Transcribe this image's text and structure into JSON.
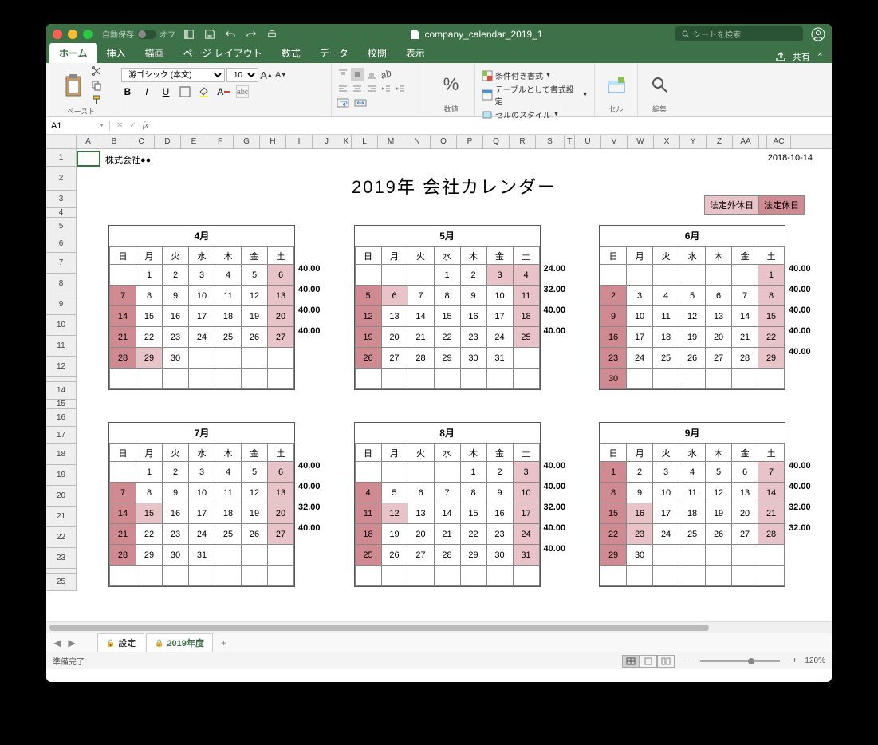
{
  "titlebar": {
    "autosave": "自動保存",
    "autosave_state": "オフ",
    "filename": "company_calendar_2019_1",
    "search_placeholder": "シートを検索"
  },
  "tabs": {
    "home": "ホーム",
    "insert": "挿入",
    "draw": "描画",
    "layout": "ページ レイアウト",
    "formulas": "数式",
    "data": "データ",
    "review": "校閲",
    "view": "表示",
    "share": "共有"
  },
  "ribbon": {
    "paste": "ペースト",
    "font_name": "游ゴシック (本文)",
    "font_size": "10",
    "number": "数値",
    "cond_format": "条件付き書式",
    "table_format": "テーブルとして書式設定",
    "cell_styles": "セルのスタイル",
    "cells": "セル",
    "editing": "編集"
  },
  "namebox": "A1",
  "cols": [
    "A",
    "B",
    "C",
    "D",
    "E",
    "F",
    "G",
    "H",
    "I",
    "J",
    "K",
    "L",
    "M",
    "N",
    "O",
    "P",
    "Q",
    "R",
    "S",
    "T",
    "U",
    "V",
    "W",
    "X",
    "Y",
    "Z",
    "AA",
    "",
    "AC"
  ],
  "rows": [
    "1",
    "2",
    "3",
    "4",
    "5",
    "6",
    "7",
    "8",
    "9",
    "10",
    "11",
    "12",
    "",
    "14",
    "15",
    "16",
    "17",
    "18",
    "19",
    "20",
    "21",
    "22",
    "23",
    "",
    "25"
  ],
  "sheet": {
    "company": "株式会社●●",
    "date": "2018-10-14",
    "title": "2019年 会社カレンダー",
    "legend_extra": "法定外休日",
    "legend_legal": "法定休日",
    "weekdays": [
      "日",
      "月",
      "火",
      "水",
      "木",
      "金",
      "土"
    ]
  },
  "months": [
    {
      "name": "4月",
      "offset": 1,
      "days": 30,
      "hours": [
        "40.00",
        "40.00",
        "40.00",
        "40.00"
      ],
      "legal": [
        7,
        14,
        21,
        28
      ],
      "extra": [
        6,
        13,
        20,
        27,
        29
      ]
    },
    {
      "name": "5月",
      "offset": 3,
      "days": 31,
      "hours": [
        "24.00",
        "32.00",
        "40.00",
        "40.00"
      ],
      "legal": [
        5,
        12,
        19,
        26
      ],
      "extra": [
        3,
        4,
        6,
        11,
        18,
        25
      ]
    },
    {
      "name": "6月",
      "offset": 6,
      "days": 30,
      "hours": [
        "40.00",
        "40.00",
        "40.00",
        "40.00",
        "40.00"
      ],
      "legal": [
        2,
        9,
        16,
        23,
        30
      ],
      "extra": [
        1,
        8,
        15,
        22,
        29
      ]
    },
    {
      "name": "7月",
      "offset": 1,
      "days": 31,
      "hours": [
        "40.00",
        "40.00",
        "32.00",
        "40.00"
      ],
      "legal": [
        7,
        14,
        21,
        28
      ],
      "extra": [
        6,
        13,
        15,
        20,
        27
      ]
    },
    {
      "name": "8月",
      "offset": 4,
      "days": 31,
      "hours": [
        "40.00",
        "40.00",
        "32.00",
        "40.00",
        "40.00"
      ],
      "legal": [
        4,
        11,
        18,
        25
      ],
      "extra": [
        3,
        10,
        12,
        17,
        24,
        31
      ]
    },
    {
      "name": "9月",
      "offset": 0,
      "days": 30,
      "hours": [
        "40.00",
        "40.00",
        "32.00",
        "32.00"
      ],
      "legal": [
        1,
        8,
        15,
        22,
        29
      ],
      "extra": [
        7,
        14,
        16,
        21,
        23,
        28
      ]
    }
  ],
  "sheettabs": {
    "settings": "設定",
    "fy2019": "2019年度"
  },
  "status": {
    "ready": "準備完了",
    "zoom": "120%"
  }
}
